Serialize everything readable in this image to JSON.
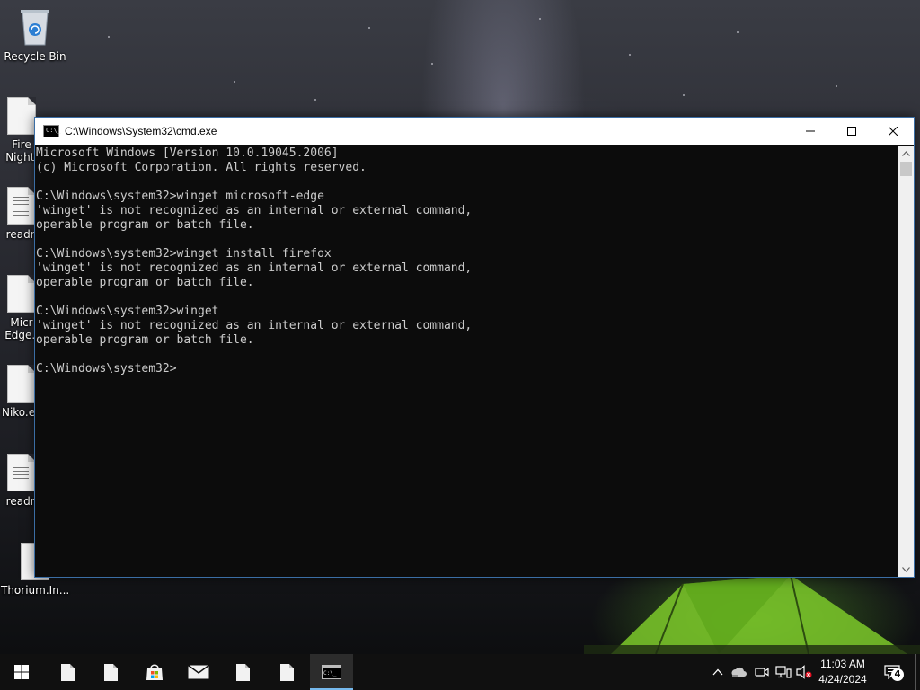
{
  "desktop": {
    "icons": [
      {
        "label": "Recycle Bin",
        "icon": "recycle-bin-icon"
      },
      {
        "label": "Fire\nNightl",
        "icon": "file-icon"
      },
      {
        "label": "readn",
        "icon": "text-file-icon"
      },
      {
        "label": "Micr\nEdge.I",
        "icon": "file-icon"
      },
      {
        "label": "Niko.ex",
        "icon": "file-icon"
      },
      {
        "label": "readn",
        "icon": "text-file-icon"
      },
      {
        "label": "Thorium.In...",
        "icon": "file-icon"
      }
    ]
  },
  "window": {
    "title": "C:\\Windows\\System32\\cmd.exe",
    "icon": "cmd-icon",
    "icon_text": "C:\\_",
    "console_lines": [
      "Microsoft Windows [Version 10.0.19045.2006]",
      "(c) Microsoft Corporation. All rights reserved.",
      "",
      "C:\\Windows\\system32>winget microsoft-edge",
      "'winget' is not recognized as an internal or external command,",
      "operable program or batch file.",
      "",
      "C:\\Windows\\system32>winget install firefox",
      "'winget' is not recognized as an internal or external command,",
      "operable program or batch file.",
      "",
      "C:\\Windows\\system32>winget",
      "'winget' is not recognized as an internal or external command,",
      "operable program or batch file.",
      "",
      "C:\\Windows\\system32>"
    ]
  },
  "taskbar": {
    "buttons": [
      {
        "icon": "windows-start-icon"
      },
      {
        "icon": "file-icon"
      },
      {
        "icon": "file-icon"
      },
      {
        "icon": "microsoft-store-icon"
      },
      {
        "icon": "mail-icon"
      },
      {
        "icon": "file-icon"
      },
      {
        "icon": "file-icon"
      },
      {
        "icon": "cmd-icon",
        "active": true
      }
    ],
    "tray": {
      "icons": [
        "chevron-up-icon",
        "cloud-icon",
        "meet-now-icon",
        "network-icon",
        "volume-muted-icon"
      ],
      "time": "11:03 AM",
      "date": "4/24/2024",
      "notification_count": "4"
    }
  },
  "colors": {
    "console_bg": "#0c0c0c",
    "console_fg": "#cccccc",
    "taskbar_bg": "#101010",
    "active_accent": "#76b9ed"
  }
}
